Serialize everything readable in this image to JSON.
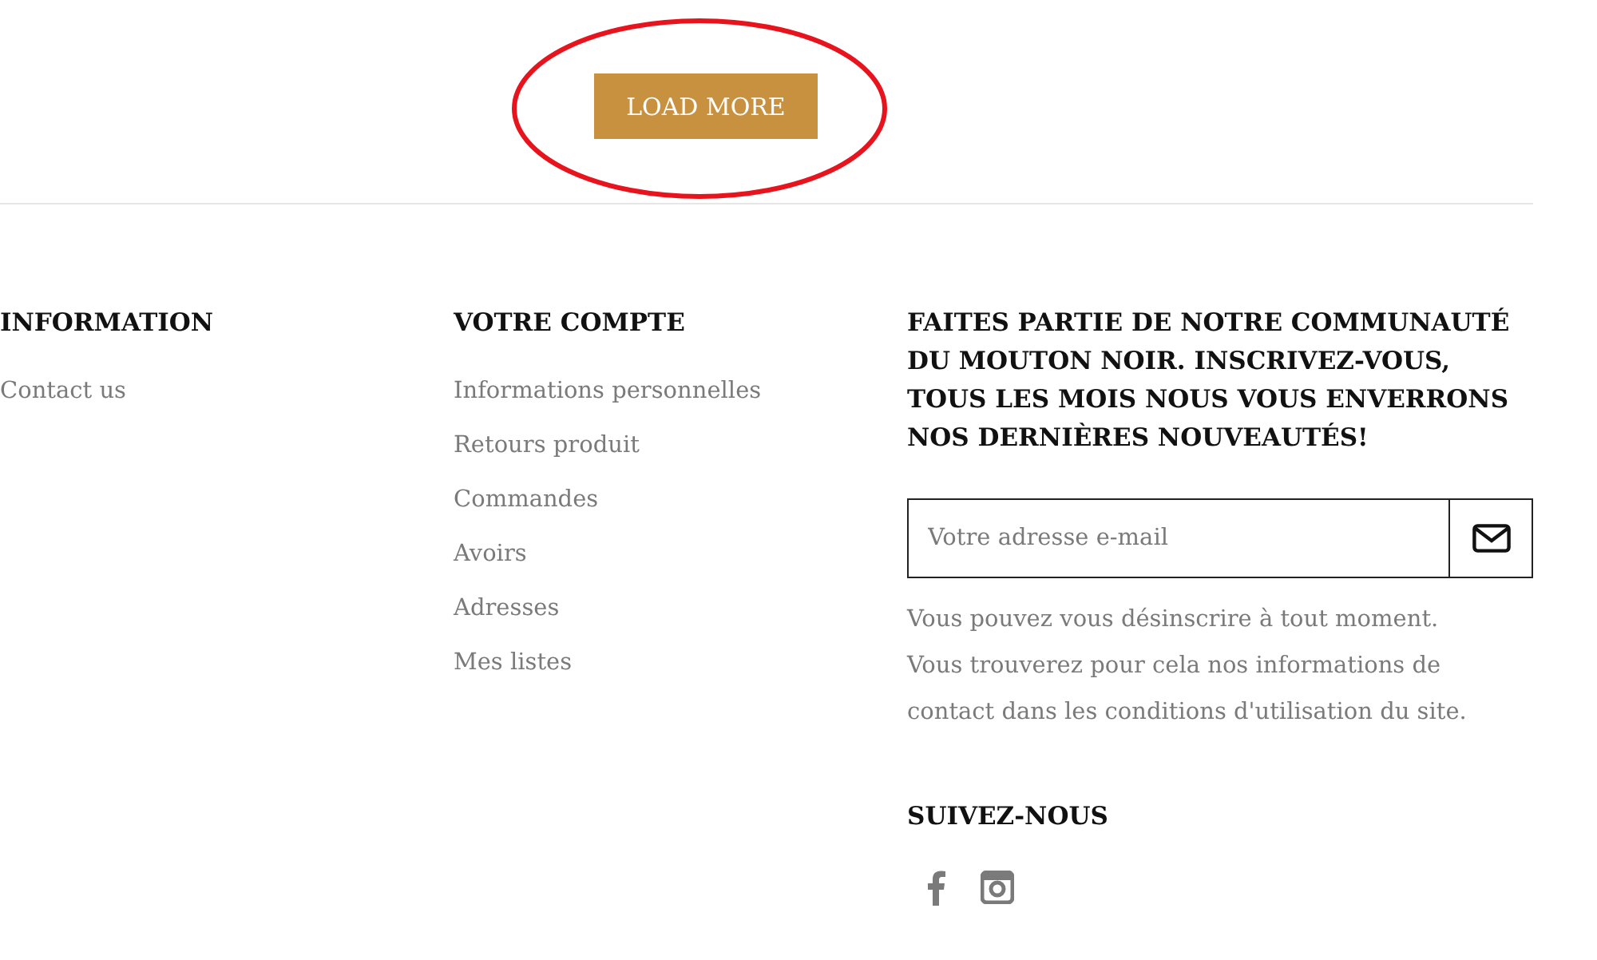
{
  "load_more": {
    "label": "LOAD MORE"
  },
  "columns": [
    {
      "title": "INFORMATION",
      "links": [
        "Contact us"
      ]
    },
    {
      "title": "VOTRE COMPTE",
      "links": [
        "Informations personnelles",
        "Retours produit",
        "Commandes",
        "Avoirs",
        "Adresses",
        "Mes listes"
      ]
    }
  ],
  "newsletter": {
    "title": "FAITES PARTIE DE NOTRE COMMUNAUTÉ DU MOUTON NOIR. INSCRIVEZ-VOUS, TOUS LES MOIS NOUS VOUS ENVERRONS NOS DERNIÈRES NOUVEAUTÉS!",
    "placeholder": "Votre adresse e-mail",
    "note": "Vous pouvez vous désinscrire à tout moment. Vous trouverez pour cela nos informations de contact dans les conditions d'utilisation du site."
  },
  "social": {
    "title": "SUIVEZ-NOUS",
    "networks": [
      {
        "kind": "facebook"
      },
      {
        "kind": "instagram"
      }
    ]
  }
}
